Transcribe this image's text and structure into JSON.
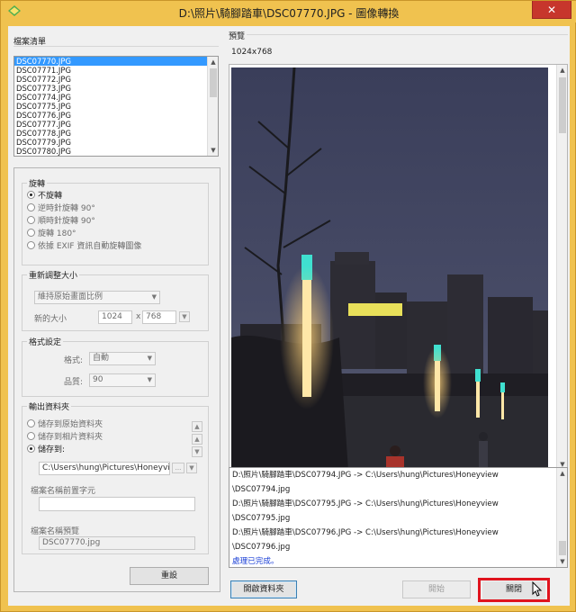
{
  "window": {
    "title": "D:\\照片\\騎腳踏車\\DSC07770.JPG - 圖像轉換",
    "close_glyph": "✕",
    "frame_color": "#f0c24f",
    "close_color": "#c7362c"
  },
  "file_list": {
    "label": "檔案清單",
    "items": [
      "DSC07770.JPG",
      "DSC07771.JPG",
      "DSC07772.JPG",
      "DSC07773.JPG",
      "DSC07774.JPG",
      "DSC07775.JPG",
      "DSC07776.JPG",
      "DSC07777.JPG",
      "DSC07778.JPG",
      "DSC07779.JPG",
      "DSC07780.JPG"
    ],
    "selected_index": 0,
    "selection_color": "#3399ff"
  },
  "rotate": {
    "title": "旋轉",
    "options": [
      "不旋轉",
      "逆時針旋轉 90°",
      "順時針旋轉 90°",
      "旋轉 180°",
      "依據 EXIF 資訊自動旋轉圖像"
    ],
    "selected_index": 0
  },
  "resize": {
    "title": "重新調整大小",
    "mode": "維持原始畫面比例",
    "new_size_label": "新的大小",
    "width": "1024",
    "x_sep": "x",
    "height": "768"
  },
  "format": {
    "title": "格式設定",
    "format_label": "格式:",
    "format_value": "自動",
    "quality_label": "品質:",
    "quality_value": "90"
  },
  "output": {
    "title": "輸出資料夾",
    "options": [
      "儲存到原始資料夾",
      "儲存到相片資料夾",
      "儲存到:"
    ],
    "selected_index": 2,
    "path": "C:\\Users\\hung\\Pictures\\Honeyview",
    "browse_label": "...",
    "prefix_label": "檔案名稱前置字元",
    "prefix_value": "",
    "preview_label": "檔案名稱預覽",
    "preview_value": "DSC07770.jpg"
  },
  "buttons": {
    "reset": "重設",
    "open_folder": "開啟資料夾",
    "start": "開始",
    "close": "關閉"
  },
  "preview": {
    "label": "預覽",
    "dimensions": "1024x768"
  },
  "log": {
    "lines": [
      "D:\\照片\\騎腳踏車\\DSC07794.JPG -> C:\\Users\\hung\\Pictures\\Honeyview",
      "\\DSC07794.jpg",
      "D:\\照片\\騎腳踏車\\DSC07795.JPG -> C:\\Users\\hung\\Pictures\\Honeyview",
      "\\DSC07795.jpg",
      "D:\\照片\\騎腳踏車\\DSC07796.JPG -> C:\\Users\\hung\\Pictures\\Honeyview",
      "\\DSC07796.jpg"
    ],
    "done": "處理已完成。",
    "done_color": "#1a3fd6"
  },
  "icons": {
    "app": "app-diamond-icon",
    "cursor": "mouse-pointer-icon",
    "up": "▲",
    "down": "▼",
    "left": "◀",
    "right": "▶",
    "dropdown": "▼"
  },
  "annotation": {
    "highlight_color": "#e0141e"
  }
}
